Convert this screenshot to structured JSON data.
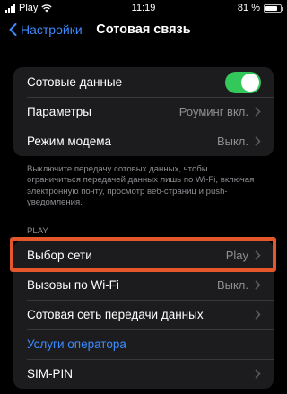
{
  "status_bar": {
    "carrier": "Play",
    "time": "11:19",
    "battery_text": "81 %",
    "battery_level": 0.81
  },
  "nav": {
    "back_label": "Настройки",
    "title": "Сотовая связь"
  },
  "group1": {
    "cellular_data": {
      "label": "Сотовые данные",
      "toggle_on": true
    },
    "parameters": {
      "label": "Параметры",
      "value": "Роуминг вкл."
    },
    "modem": {
      "label": "Режим модема",
      "value": "Выкл."
    }
  },
  "footer_note": "Выключите передачу сотовых данных, чтобы ограничиться передачей данных лишь по Wi-Fi, включая электронную почту, просмотр веб-страниц и push-уведомления.",
  "section": {
    "header": "PLAY",
    "network_selection": {
      "label": "Выбор сети",
      "value": "Play"
    },
    "wifi_calls": {
      "label": "Вызовы по Wi-Fi",
      "value": "Выкл."
    },
    "cellular_network": {
      "label": "Сотовая сеть передачи данных"
    },
    "operator_services": {
      "label": "Услуги оператора"
    },
    "sim_pin": {
      "label": "SIM-PIN"
    }
  },
  "colors": {
    "accent": "#3d8bff",
    "toggle_on": "#34c759",
    "highlight": "#e5572b"
  }
}
